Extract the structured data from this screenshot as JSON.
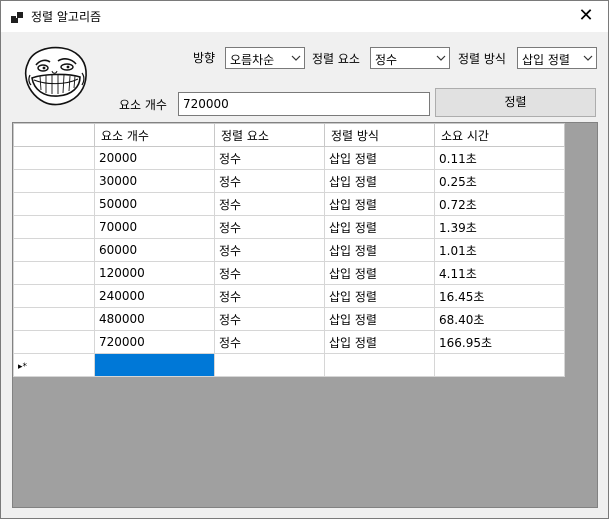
{
  "window": {
    "title": "정렬 알고리즘",
    "close_glyph": "✕"
  },
  "controls": {
    "direction": {
      "label": "방향",
      "value": "오름차순"
    },
    "element": {
      "label": "정렬 요소",
      "value": "정수"
    },
    "method": {
      "label": "정렬 방식",
      "value": "삽입 정렬"
    },
    "count": {
      "label": "요소 개수",
      "value": "720000"
    },
    "sort_button": "정렬"
  },
  "icons": {
    "app": "app-windows-icon",
    "logo": "trollface-icon",
    "dropdown": "chevron-down-icon",
    "new_row": "new-row-indicator-icon"
  },
  "grid": {
    "columns": [
      "요소 개수",
      "정렬 요소",
      "정렬 방식",
      "소요 시간"
    ],
    "rows": [
      [
        "20000",
        "정수",
        "삽입 정렬",
        "0.11초"
      ],
      [
        "30000",
        "정수",
        "삽입 정렬",
        "0.25초"
      ],
      [
        "50000",
        "정수",
        "삽입 정렬",
        "0.72초"
      ],
      [
        "70000",
        "정수",
        "삽입 정렬",
        "1.39초"
      ],
      [
        "60000",
        "정수",
        "삽입 정렬",
        "1.01초"
      ],
      [
        "120000",
        "정수",
        "삽입 정렬",
        "4.11초"
      ],
      [
        "240000",
        "정수",
        "삽입 정렬",
        "16.45초"
      ],
      [
        "480000",
        "정수",
        "삽입 정렬",
        "68.40초"
      ],
      [
        "720000",
        "정수",
        "삽입 정렬",
        "166.95초"
      ]
    ],
    "new_row_marker": "▸*",
    "selection_color": "#0078d7",
    "background_color": "#a0a0a0"
  }
}
